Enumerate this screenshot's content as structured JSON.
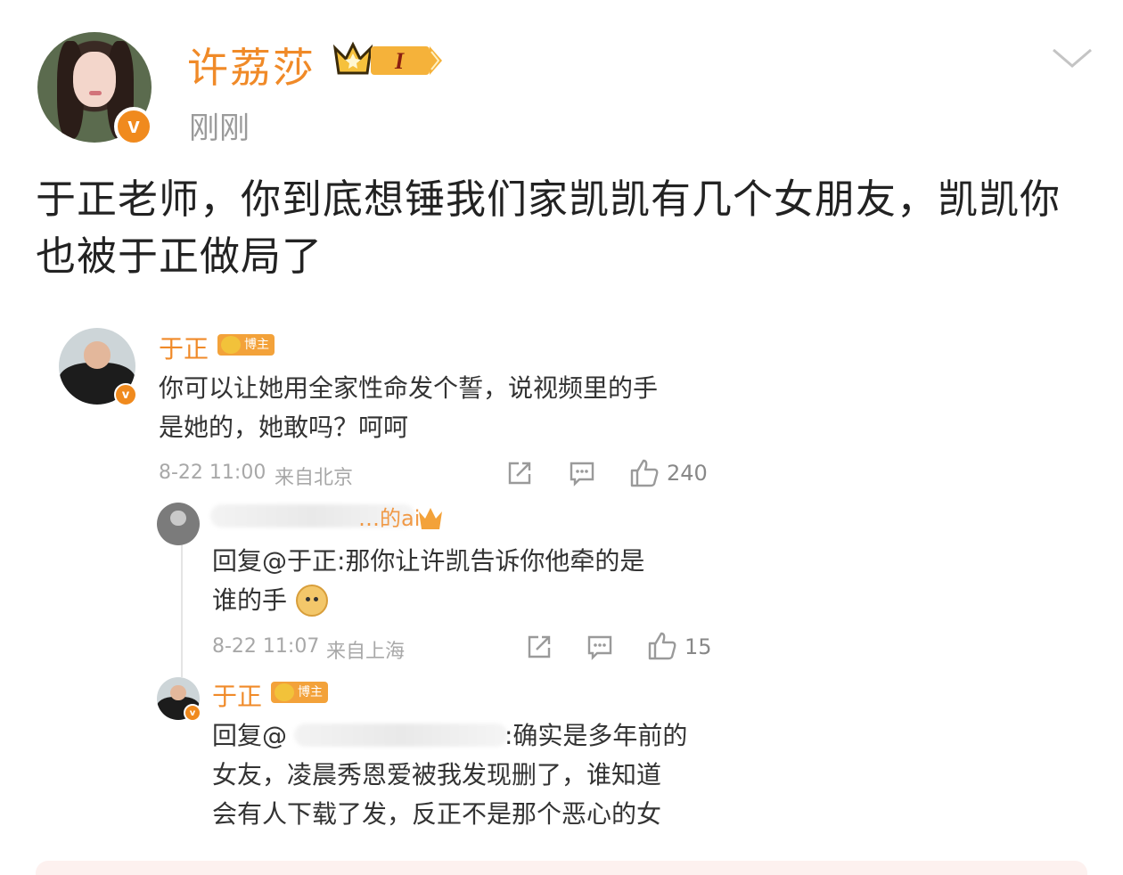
{
  "post": {
    "username": "许荔莎",
    "level_badge": "I",
    "verified_mark": "v",
    "timestamp": "刚刚",
    "text": "于正老师，你到底想锤我们家凯凯有几个女朋友，凯凯你也被于正做局了"
  },
  "icons": {
    "header_menu": "chevron-down-icon",
    "share": "share-icon",
    "comment": "comment-icon",
    "like": "thumbs-up-icon"
  },
  "colors": {
    "name": "#f08a28",
    "verified": "#f08a1e",
    "meta": "#a8a8a8"
  },
  "screenshot": {
    "comment1": {
      "name": "于正",
      "tag": "博主",
      "text_line1": "你可以让她用全家性命发个誓，说视频里的手",
      "text_line2": "是她的，她敢吗？呵呵",
      "time": "8-22 11:00",
      "location": "来自北京",
      "likes": "240"
    },
    "reply1": {
      "name_visible_part": "…的ai",
      "text_line1": "回复@于正:那你让许凯告诉你他牵的是",
      "text_line2": "谁的手",
      "time": "8-22 11:07",
      "location": "来自上海",
      "likes": "15"
    },
    "reply2": {
      "name": "于正",
      "tag": "博主",
      "text_prefix": "回复@",
      "text_line1_end": ":确实是多年前的",
      "text_line2": "女友，凌晨秀恩爱被我发现删了，谁知道",
      "text_line3": "会有人下载了发，反正不是那个恶心的女"
    }
  }
}
